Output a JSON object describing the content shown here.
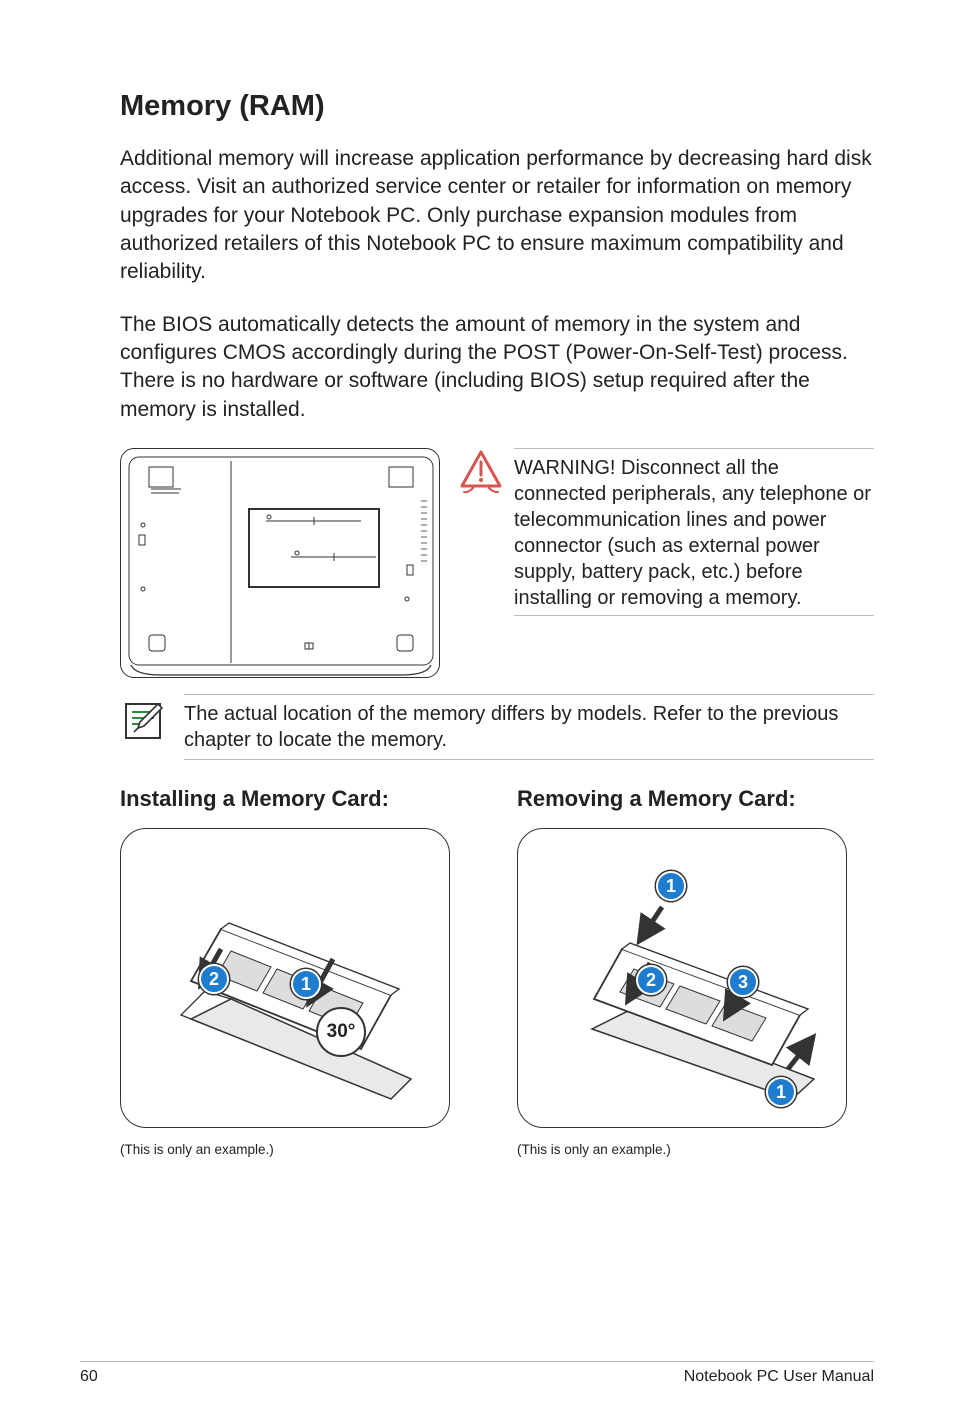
{
  "heading": "Memory (RAM)",
  "para1": "Additional memory will increase application performance by decreasing hard disk access. Visit an authorized service center or retailer for information on memory upgrades for your Notebook PC. Only purchase expansion modules from authorized retailers of this Notebook PC to ensure maximum compatibility and reliability.",
  "para2": "The BIOS automatically detects the amount of memory in the system and configures CMOS accordingly during the POST (Power-On-Self-Test) process. There is no hardware or software (including BIOS) setup required after the memory is installed.",
  "warning_text": "WARNING! Disconnect all the connected peripherals, any telephone or telecommunication lines and power connector (such as external power supply, battery pack, etc.) before installing or removing a memory.",
  "note_text": "The actual location of the memory differs by models. Refer to the previous chapter to locate the memory.",
  "install_heading": "Installing a Memory Card:",
  "remove_heading": "Removing a Memory Card:",
  "example_caption": "(This is only an example.)",
  "angle_label": "30°",
  "badges": {
    "one": "1",
    "two": "2",
    "three": "3"
  },
  "footer_page": "60",
  "footer_title": "Notebook PC User Manual"
}
